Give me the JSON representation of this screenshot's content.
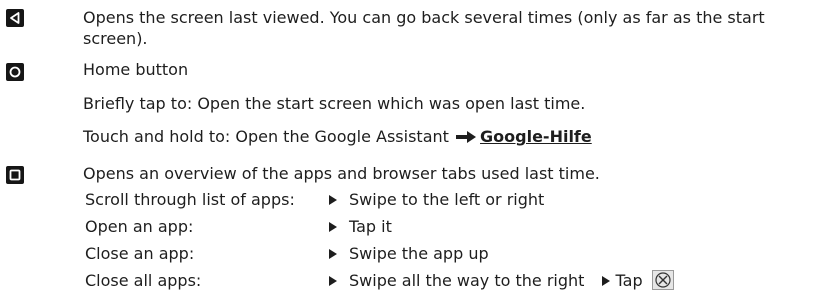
{
  "back": {
    "line1": "Opens the screen last viewed. You can go back several times (only as far as the start",
    "line2": "screen)."
  },
  "home": {
    "title": "Home button",
    "brief": "Briefly tap to: Open the start screen which was open last time.",
    "touch": "Touch and hold to: Open the Google Assistant",
    "link": "Google-Hilfe"
  },
  "overview": {
    "desc": "Opens an overview of the apps and browser tabs used last time.",
    "rows": [
      {
        "label": "Scroll through list of apps:",
        "action": "Swipe to the left or right"
      },
      {
        "label": "Open an app:",
        "action": "Tap it"
      },
      {
        "label": "Close an app:",
        "action": "Swipe the app up"
      },
      {
        "label": "Close all apps:",
        "action": "Swipe all the way to the right",
        "action2": "Tap"
      }
    ]
  },
  "icons": {
    "back": "back-triangle-icon",
    "home": "home-circle-icon",
    "overview": "overview-square-icon",
    "arrow": "right-arrow-icon",
    "bullet": "bullet-triangle-icon",
    "close": "close-x-icon"
  }
}
